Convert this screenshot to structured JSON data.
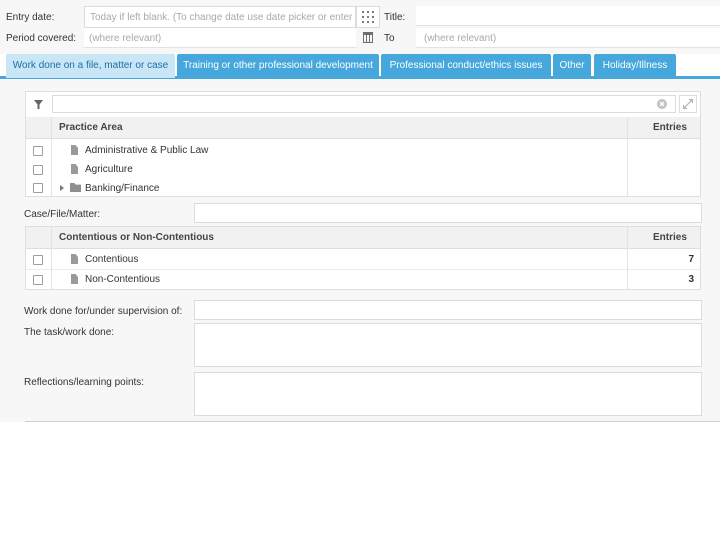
{
  "header": {
    "entry_date_label": "Entry date:",
    "entry_date_placeholder": "Today if left blank. (To change date use date picker or enter i",
    "title_label": "Title:",
    "period_label": "Period covered:",
    "period_from_placeholder": "(where relevant)",
    "to_label": "To",
    "period_to_placeholder": "(where relevant)"
  },
  "tabs": [
    {
      "label": "Work done on a file, matter or case",
      "active": true
    },
    {
      "label": "Training or other professional development",
      "active": false
    },
    {
      "label": "Professional conduct/ethics issues",
      "active": false
    },
    {
      "label": "Other",
      "active": false
    },
    {
      "label": "Holiday/Illness",
      "active": false
    }
  ],
  "practice_grid": {
    "col_area": "Practice Area",
    "col_entries": "Entries",
    "rows": [
      {
        "label": "Administrative & Public Law",
        "entries": "",
        "icon": "file-icon"
      },
      {
        "label": "Agriculture",
        "entries": "",
        "icon": "file-icon"
      },
      {
        "label": "Banking/Finance",
        "entries": "",
        "icon": "folder-icon"
      }
    ]
  },
  "case_label": "Case/File/Matter:",
  "contentious_grid": {
    "col_area": "Contentious or Non-Contentious",
    "col_entries": "Entries",
    "rows": [
      {
        "label": "Contentious",
        "entries": "7",
        "icon": "file-icon"
      },
      {
        "label": "Non-Contentious",
        "entries": "3",
        "icon": "file-icon"
      }
    ]
  },
  "supervision_label": "Work done for/under supervision of:",
  "task_label": "The task/work done:",
  "reflections_label": "Reflections/learning points:",
  "colors": {
    "tab": "#45a7dc",
    "tab_active_bg": "#c9e6f7",
    "panel_bg": "#f7f7f7"
  }
}
